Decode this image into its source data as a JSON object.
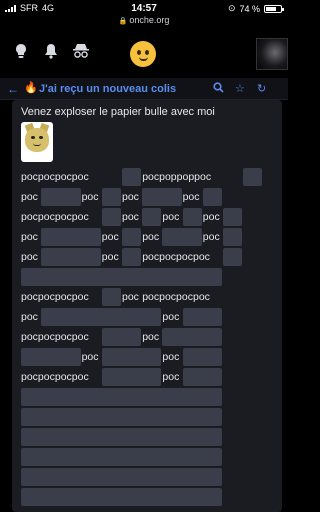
{
  "status_bar": {
    "carrier": "SFR",
    "network": "4G",
    "time": "14:57",
    "battery": "74 %",
    "battery_level": 0.74
  },
  "url": "onche.org",
  "header": {
    "icons": [
      "lightbulb-icon",
      "bell-icon",
      "incognito-icon"
    ],
    "logo": "smiley-logo"
  },
  "topic": {
    "title": "J'ai reçu un nouveau colis",
    "icons": [
      "search-icon",
      "star-icon",
      "refresh-icon"
    ]
  },
  "message": {
    "text": "Venez exploser le papier bulle avec moi",
    "rows": [
      [
        {
          "t": "pocpocpocpoc",
          "w": 5
        },
        {
          "t": "poc",
          "w": 1,
          "h": 1
        },
        {
          "t": "pocpoppoppoc",
          "w": 5
        },
        {
          "t": "poc",
          "w": 1,
          "h": 1
        }
      ],
      [
        {
          "t": "poc",
          "w": 1
        },
        {
          "t": "pocpoc",
          "w": 2,
          "h": 1
        },
        {
          "t": "poc",
          "w": 1
        },
        {
          "t": "poc",
          "w": 1,
          "h": 1
        },
        {
          "t": "poc",
          "w": 1
        },
        {
          "t": "pocpoc",
          "w": 2,
          "h": 1
        },
        {
          "t": "poc",
          "w": 1
        },
        {
          "t": "poc",
          "w": 1,
          "h": 1
        }
      ],
      [
        {
          "t": "pocpocpocpoc",
          "w": 4
        },
        {
          "t": "poc",
          "w": 1,
          "h": 1
        },
        {
          "t": "poc",
          "w": 1
        },
        {
          "t": "poc",
          "w": 1,
          "h": 1
        },
        {
          "t": "poc",
          "w": 1
        },
        {
          "t": "poc",
          "w": 1,
          "h": 1
        },
        {
          "t": "poc",
          "w": 1
        },
        {
          "t": "poc",
          "w": 1,
          "h": 1
        }
      ],
      [
        {
          "t": "poc",
          "w": 1
        },
        {
          "t": "pocpocpoc",
          "w": 3,
          "h": 1
        },
        {
          "t": "poc",
          "w": 1
        },
        {
          "t": "poc",
          "w": 1,
          "h": 1
        },
        {
          "t": "poc",
          "w": 1
        },
        {
          "t": "pocpoc",
          "w": 2,
          "h": 1
        },
        {
          "t": "poc",
          "w": 1
        },
        {
          "t": "poc",
          "w": 1,
          "h": 1
        }
      ],
      [
        {
          "t": "poc",
          "w": 1
        },
        {
          "t": "pocpocpoc",
          "w": 3,
          "h": 1
        },
        {
          "t": "poc",
          "w": 1
        },
        {
          "t": "poc",
          "w": 1,
          "h": 1
        },
        {
          "t": "pocpocpocpoc",
          "w": 4
        },
        {
          "t": "poc",
          "w": 1,
          "h": 1
        }
      ],
      [
        {
          "t": "pocpocpocpocpocpocpocpocpocpoc",
          "w": 10,
          "h": 1
        }
      ],
      [
        {
          "t": "pocpocpocpoc",
          "w": 4
        },
        {
          "t": "poc",
          "w": 1,
          "h": 1
        },
        {
          "t": "poc",
          "w": 1
        },
        {
          "t": "pocpocpocpoc",
          "w": 4
        }
      ],
      [
        {
          "t": "poc",
          "w": 1
        },
        {
          "t": "pocpocpocpocpocpoc",
          "w": 6,
          "h": 1
        },
        {
          "t": "poc",
          "w": 1
        },
        {
          "t": "pocpoc",
          "w": 2,
          "h": 1
        }
      ],
      [
        {
          "t": "pocpocpocpoc",
          "w": 4
        },
        {
          "t": "pocpoc",
          "w": 2,
          "h": 1
        },
        {
          "t": "poc",
          "w": 1
        },
        {
          "t": "pocpocpoc",
          "w": 3,
          "h": 1
        }
      ],
      [
        {
          "t": "pocpocpoc",
          "w": 3,
          "h": 1
        },
        {
          "t": "poc",
          "w": 1
        },
        {
          "t": "pocpocpoc",
          "w": 3,
          "h": 1
        },
        {
          "t": "poc",
          "w": 1
        },
        {
          "t": "pocpoc",
          "w": 2,
          "h": 1
        }
      ],
      [
        {
          "t": "pocpocpocpoc",
          "w": 4
        },
        {
          "t": "pocpocpoc",
          "w": 3,
          "h": 1
        },
        {
          "t": "poc",
          "w": 1
        },
        {
          "t": "pocpoc",
          "w": 2,
          "h": 1
        }
      ],
      [
        {
          "t": "pocpocpocpocpocpocpocpocpocpoc",
          "w": 10,
          "h": 1
        }
      ],
      [
        {
          "t": "pocpocpocpocpocpocpocpocpocpoc",
          "w": 10,
          "h": 1
        }
      ],
      [
        {
          "t": "pocpocpocpocpocpocpocpocpocpoc",
          "w": 10,
          "h": 1
        }
      ],
      [
        {
          "t": "pocpocpocpocpocpocpocpocpocpoc",
          "w": 10,
          "h": 1
        }
      ],
      [
        {
          "t": "pocpocpocpocpocpocpocpocpocpoc",
          "w": 10,
          "h": 1
        }
      ],
      [
        {
          "t": "pocpocpocpocpocpocpocpocpocpoc",
          "w": 10,
          "h": 1
        }
      ]
    ]
  },
  "colors": {
    "accent": "#5b8def",
    "spoiler": "#3a3e4b",
    "bg": "#000000",
    "card": "#1a1c22"
  }
}
